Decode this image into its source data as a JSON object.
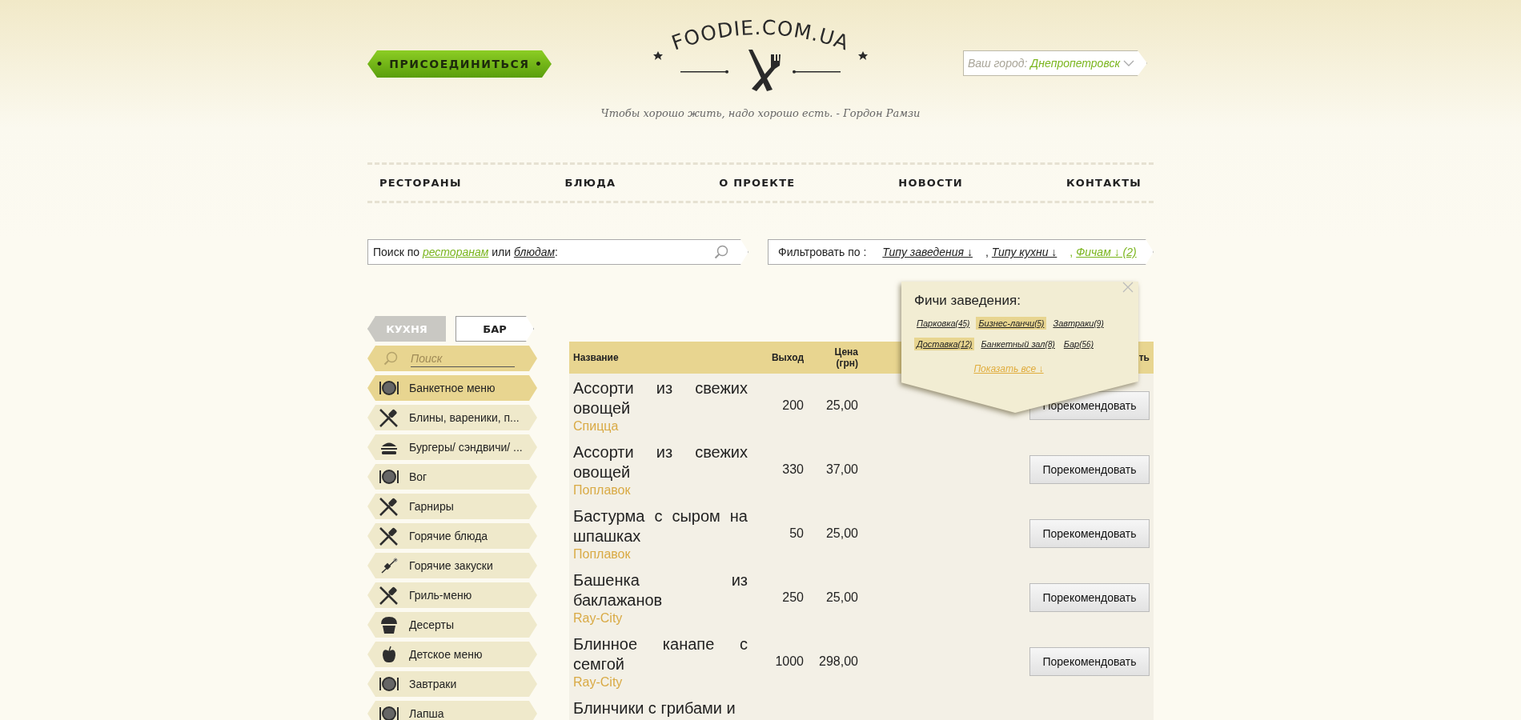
{
  "header": {
    "join_button": "• ПРИСОЕДИНИТЬСЯ •",
    "logo": "FOODIE.COM.UA",
    "tagline": "Чтобы хорошо жить, надо хорошо есть. - Гордон Рамзи",
    "city": {
      "label": "Ваш город:",
      "value": "Днепропетровск"
    }
  },
  "nav": [
    {
      "label": "РЕСТОРАНЫ"
    },
    {
      "label": "БЛЮДА"
    },
    {
      "label": "О ПРОЕКТЕ"
    },
    {
      "label": "НОВОСТИ"
    },
    {
      "label": "КОНТАКТЫ"
    }
  ],
  "search": {
    "parts": [
      {
        "kind": "text",
        "text": "Поиск по "
      },
      {
        "kind": "link",
        "text": "ресторанам",
        "selected": true
      },
      {
        "kind": "text",
        "text": " или "
      },
      {
        "kind": "link",
        "text": "блюдам",
        "selected": false
      },
      {
        "kind": "text",
        "text": ":"
      }
    ]
  },
  "filter": {
    "label": "Фильтровать по :",
    "items": [
      {
        "label": "Типу заведения ↓",
        "active": false
      },
      {
        "separator": ",",
        "label": "Типу кухни ↓",
        "active": false
      },
      {
        "separator": ",",
        "label": "Фичам ↓ (2)",
        "active": true
      }
    ]
  },
  "features_popup": {
    "title": "Фичи заведения:",
    "tags": [
      {
        "label": "Парковка",
        "count": "(45)",
        "selected": false
      },
      {
        "label": "Бизнес-ланчи",
        "count": "(5)",
        "selected": true
      },
      {
        "label": "Завтраки",
        "count": "(9)",
        "selected": false
      },
      {
        "label": "Доставка",
        "count": "(12)",
        "selected": true
      },
      {
        "label": "Банкетный зал",
        "count": "(8)",
        "selected": false
      },
      {
        "label": "Бар",
        "count": "(56)",
        "selected": false
      }
    ],
    "show_all": "Показать все ↓"
  },
  "tabs": [
    {
      "label": "КУХНЯ",
      "selected": true
    },
    {
      "label": "БАР",
      "selected": false
    }
  ],
  "sidebar": {
    "search_placeholder": "Поиск",
    "items": [
      {
        "label": "Банкетное меню",
        "kind": "plate",
        "selected": true
      },
      {
        "label": "Блины, вареники, п...",
        "kind": "cutlery",
        "selected": false
      },
      {
        "label": "Бургеры/ сэндвичи/ ...",
        "kind": "burger",
        "selected": false
      },
      {
        "label": "Вог",
        "kind": "plate",
        "selected": false
      },
      {
        "label": "Гарниры",
        "kind": "cutlery",
        "selected": false
      },
      {
        "label": "Горячие блюда",
        "kind": "cutlery",
        "selected": false
      },
      {
        "label": "Горячие закуски",
        "kind": "skewer",
        "selected": false
      },
      {
        "label": "Гриль-меню",
        "kind": "cutlery",
        "selected": false
      },
      {
        "label": "Десерты",
        "kind": "muffin",
        "selected": false
      },
      {
        "label": "Детское меню",
        "kind": "apple",
        "selected": false
      },
      {
        "label": "Завтраки",
        "kind": "plate",
        "selected": false
      },
      {
        "label": "Лапша",
        "kind": "plate",
        "selected": false
      }
    ]
  },
  "table": {
    "columns": [
      "Название",
      "Выход",
      "Цена (грн)",
      "ть"
    ],
    "rows": [
      {
        "name": "Ассорти из свежих овощей",
        "venue": "Спицца",
        "yield": "200",
        "price": "25,00",
        "action": "Порекомендовать"
      },
      {
        "name": "Ассорти из свежих овощей",
        "venue": "Поплавок",
        "yield": "330",
        "price": "37,00",
        "action": "Порекомендовать"
      },
      {
        "name": "Бастурма с сыром на шпашках",
        "venue": "Поплавок",
        "yield": "50",
        "price": "25,00",
        "action": "Порекомендовать"
      },
      {
        "name": "Башенка из баклажанов",
        "venue": "Ray-City",
        "yield": "250",
        "price": "25,00",
        "action": "Порекомендовать"
      },
      {
        "name": "Блинное канапе с семгой",
        "venue": "Ray-City",
        "yield": "1000",
        "price": "298,00",
        "action": "Порекомендовать"
      },
      {
        "name": "Блинчики с грибами и"
      }
    ]
  }
}
